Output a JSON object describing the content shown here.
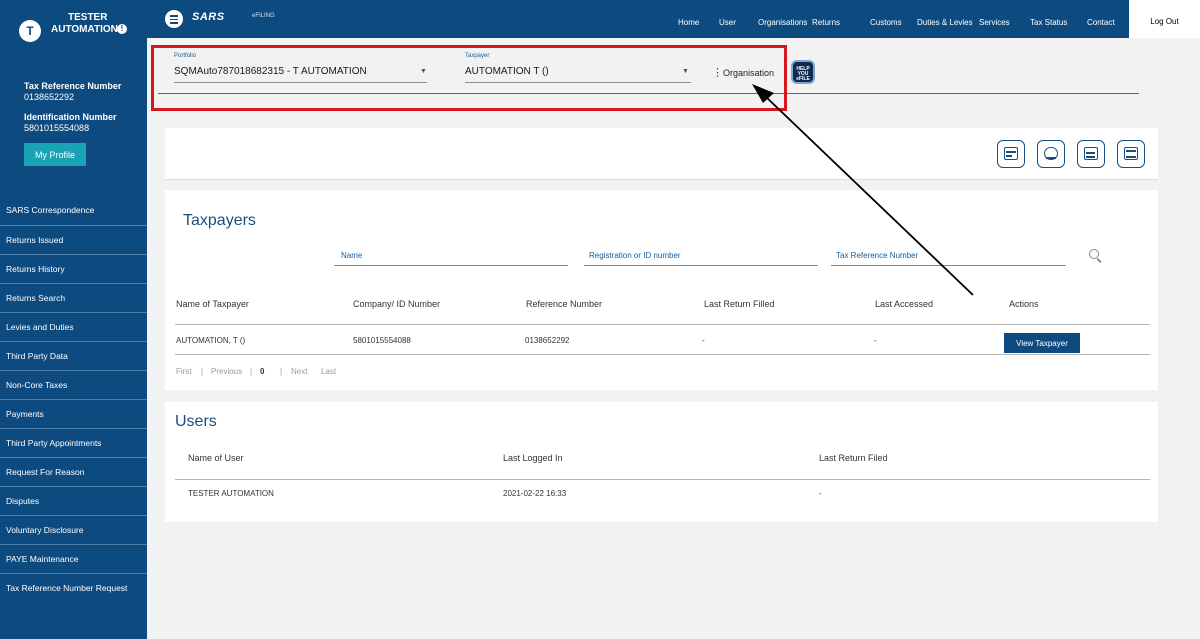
{
  "user": {
    "avatar_letter": "T",
    "name_line1": "TESTER",
    "name_line2": "AUTOMATION",
    "tax_ref_label": "Tax Reference Number",
    "tax_ref_value": "0138652292",
    "id_label": "Identification Number",
    "id_value": "5801015554088",
    "profile_button": "My Profile"
  },
  "sidebar": {
    "items": [
      {
        "label": "SARS Correspondence"
      },
      {
        "label": "Returns Issued"
      },
      {
        "label": "Returns History"
      },
      {
        "label": "Returns Search"
      },
      {
        "label": "Levies and Duties"
      },
      {
        "label": "Third Party Data"
      },
      {
        "label": "Non-Core Taxes"
      },
      {
        "label": "Payments"
      },
      {
        "label": "Third Party Appointments"
      },
      {
        "label": "Request For Reason"
      },
      {
        "label": "Disputes"
      },
      {
        "label": "Voluntary Disclosure"
      },
      {
        "label": "PAYE Maintenance"
      },
      {
        "label": "Tax Reference Number Request"
      }
    ]
  },
  "topbar": {
    "logo": "SARS",
    "logo_sub": "eFILING",
    "links": [
      {
        "label": "Home"
      },
      {
        "label": "User"
      },
      {
        "label": "Organisations"
      },
      {
        "label": "Returns"
      },
      {
        "label": "Customs"
      },
      {
        "label": "Duties & Levies"
      },
      {
        "label": "Services"
      },
      {
        "label": "Tax Status"
      },
      {
        "label": "Contact"
      }
    ],
    "logout": "Log Out"
  },
  "portfolio": {
    "portfolio_label": "Portfolio",
    "portfolio_value": "SQMAuto787018682315 - T AUTOMATION",
    "taxpayer_label": "Taxpayer",
    "taxpayer_value": "AUTOMATION T ()",
    "organisation": "Organisation",
    "help_text": "HELP YOU eFILE"
  },
  "taxpayers": {
    "title": "Taxpayers",
    "search": {
      "name": "Name",
      "reg": "Registration or ID number",
      "taxref": "Tax Reference Number"
    },
    "columns": [
      "Name of Taxpayer",
      "Company/ ID Number",
      "Reference Number",
      "Last Return Filled",
      "Last Accessed",
      "Actions"
    ],
    "rows": [
      {
        "name": "AUTOMATION, T ()",
        "id": "5801015554088",
        "ref": "0138652292",
        "last_return": "-",
        "last_accessed": "-",
        "action": "View Taxpayer"
      }
    ],
    "pager": {
      "first": "First",
      "previous": "Previous",
      "page": "0",
      "next": "Next",
      "last": "Last"
    }
  },
  "users": {
    "title": "Users",
    "columns": [
      "Name of User",
      "Last Logged In",
      "Last Return Filed"
    ],
    "rows": [
      {
        "name": "TESTER AUTOMATION",
        "logged_in": "2021-02-22 16:33",
        "last_return": "-"
      }
    ]
  },
  "colors": {
    "navy": "#0d4a80",
    "accent": "#1aa2b5",
    "highlight": "#d6171f"
  },
  "icons": [
    "menu-icon",
    "info-icon",
    "help-icon",
    "search-icon",
    "calculator-icon",
    "scanner-icon",
    "document-icon",
    "printer-icon"
  ]
}
